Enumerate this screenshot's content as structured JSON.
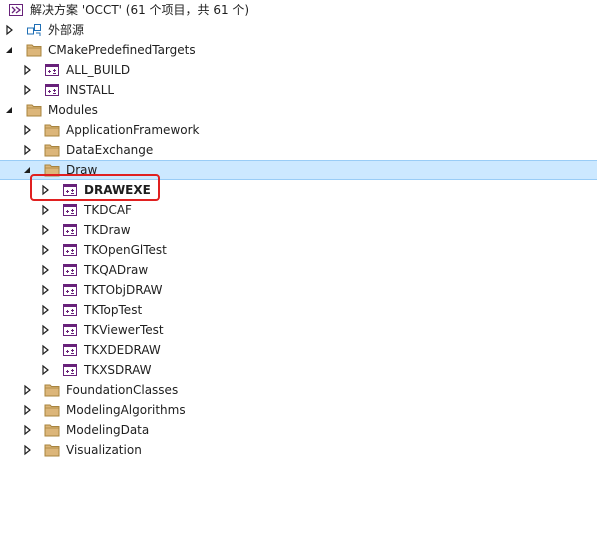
{
  "solution": {
    "title": "解决方案 'OCCT' (61 个项目，共 61 个)"
  },
  "external": {
    "label": "外部源"
  },
  "cmake": {
    "label": "CMakePredefinedTargets",
    "items": [
      "ALL_BUILD",
      "INSTALL"
    ]
  },
  "modules": {
    "label": "Modules",
    "app_framework": "ApplicationFramework",
    "data_exchange": "DataExchange",
    "draw": {
      "label": "Draw",
      "items": [
        "DRAWEXE",
        "TKDCAF",
        "TKDraw",
        "TKOpenGlTest",
        "TKQADraw",
        "TKTObjDRAW",
        "TKTopTest",
        "TKViewerTest",
        "TKXDEDRAW",
        "TKXSDRAW"
      ]
    },
    "foundation": "FoundationClasses",
    "modeling_algorithms": "ModelingAlgorithms",
    "modeling_data": "ModelingData",
    "visualization": "Visualization"
  },
  "colors": {
    "selection": "#cce8ff",
    "folder": "#dcb67a",
    "project": "#68217a",
    "highlight": "#e02020"
  }
}
